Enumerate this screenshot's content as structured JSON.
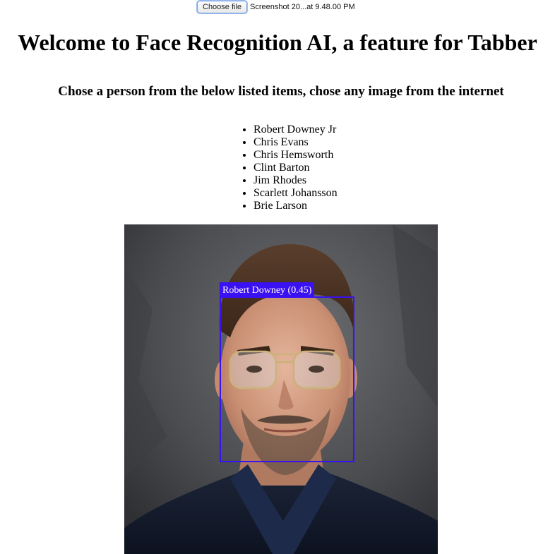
{
  "file_input": {
    "button_label": "Choose file",
    "file_name": "Screenshot 20...at 9.48.00 PM"
  },
  "header": {
    "title": "Welcome to Face Recognition AI, a feature for Tabber",
    "subtitle": "Chose a person from the below listed items, chose any image from the internet"
  },
  "people": [
    "Robert Downey Jr",
    "Chris Evans",
    "Chris Hemsworth",
    "Clint Barton",
    "Jim Rhodes",
    "Scarlett Johansson",
    "Brie Larson"
  ],
  "detection": {
    "label": "Robert Downey (0.45)",
    "box_color": "#3a11f2"
  }
}
